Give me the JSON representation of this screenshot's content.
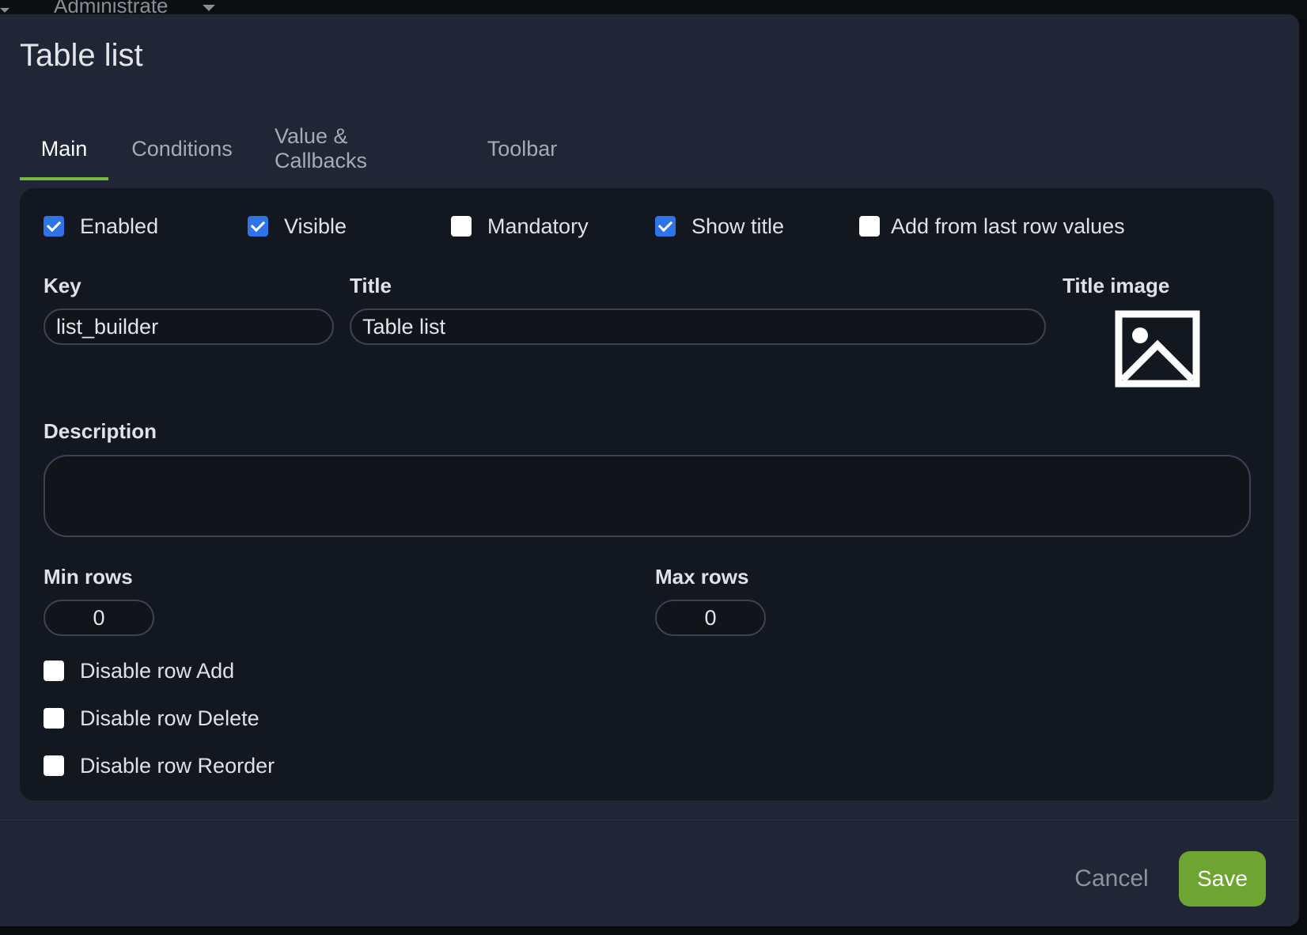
{
  "backdrop": {
    "nav_label": "Administrate"
  },
  "modal": {
    "title": "Table list"
  },
  "tabs": [
    {
      "label": "Main",
      "active": true
    },
    {
      "label": "Conditions",
      "active": false
    },
    {
      "label": "Value & Callbacks",
      "active": false
    },
    {
      "label": "Toolbar",
      "active": false
    }
  ],
  "options": {
    "enabled": {
      "label": "Enabled",
      "checked": true
    },
    "visible": {
      "label": "Visible",
      "checked": true
    },
    "mandatory": {
      "label": "Mandatory",
      "checked": false
    },
    "show_title": {
      "label": "Show title",
      "checked": true
    },
    "add_from_last": {
      "label": "Add from last row values",
      "checked": false
    }
  },
  "fields": {
    "key": {
      "label": "Key",
      "value": "list_builder"
    },
    "title": {
      "label": "Title",
      "value": "Table list"
    },
    "title_image": {
      "label": "Title image"
    },
    "description": {
      "label": "Description",
      "value": ""
    },
    "min_rows": {
      "label": "Min rows",
      "value": "0"
    },
    "max_rows": {
      "label": "Max rows",
      "value": "0"
    }
  },
  "row_options": {
    "disable_add": {
      "label": "Disable row Add",
      "checked": false
    },
    "disable_delete": {
      "label": "Disable row Delete",
      "checked": false
    },
    "disable_reorder": {
      "label": "Disable row Reorder",
      "checked": false
    }
  },
  "footer": {
    "cancel_label": "Cancel",
    "save_label": "Save"
  },
  "colors": {
    "modal_bg": "#212636",
    "panel_bg": "#131720",
    "accent_green": "#6ea532",
    "tab_underline": "#77b63a",
    "checkbox_blue": "#2f73e8"
  },
  "icons": {
    "title_image": "image-placeholder-icon",
    "checkbox_checked": "check-icon"
  }
}
